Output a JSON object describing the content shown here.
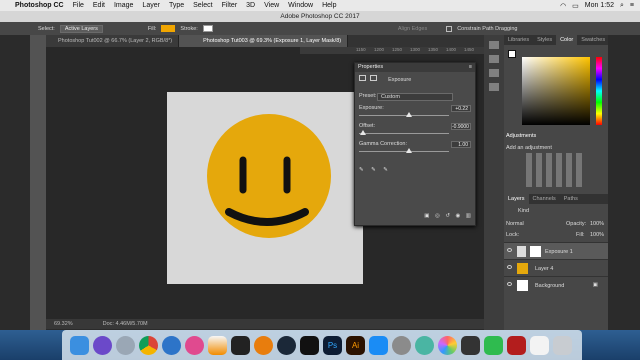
{
  "menubar": {
    "apple": "",
    "app": "Photoshop CC",
    "items": [
      "File",
      "Edit",
      "Image",
      "Layer",
      "Type",
      "Select",
      "Filter",
      "3D",
      "View",
      "Window",
      "Help"
    ],
    "clock": "Mon 1:52"
  },
  "titlebar": {
    "title": "Adobe Photoshop CC 2017"
  },
  "options": {
    "select_label": "Select:",
    "select_value": "Active Layers",
    "fill_label": "Fill:",
    "stroke_label": "Stroke:",
    "align_edges": "Align Edges",
    "constrain": "Constrain Path Dragging"
  },
  "tabs": [
    {
      "label": "Photoshop Tut002 @ 66.7% (Layer 2, RGB/8*)"
    },
    {
      "label": "Photoshop Tut003 @ 69.3% (Exposure 1, Layer Mask/8)"
    }
  ],
  "ruler": [
    "550",
    "600",
    "650",
    "700",
    "750",
    "800",
    "850",
    "900",
    "950",
    "1000",
    "1050",
    "1100",
    "1150",
    "1200",
    "1250",
    "1300",
    "1350",
    "1400",
    "1450",
    "1500"
  ],
  "properties": {
    "title": "Properties",
    "section": "Exposure",
    "preset_label": "Preset:",
    "preset_value": "Custom",
    "exposure_label": "Exposure:",
    "exposure_value": "+0.22",
    "exposure_pos": 0.55,
    "offset_label": "Offset:",
    "offset_value": "-0.9000",
    "offset_pos": 0.04,
    "gamma_label": "Gamma Correction:",
    "gamma_value": "1.00",
    "gamma_pos": 0.55
  },
  "right_panels": {
    "color_tabs": [
      "Libraries",
      "Styles",
      "Color",
      "Swatches"
    ],
    "active_color_tab": "Color",
    "adjustments_title": "Adjustments",
    "adjustments_hint": "Add an adjustment",
    "layer_tabs": [
      "Layers",
      "Channels",
      "Paths"
    ],
    "kind_label": "Kind",
    "blend_mode": "Normal",
    "opacity_label": "Opacity:",
    "opacity_value": "100%",
    "lock_label": "Lock:",
    "fill_label": "Fill:",
    "fill_value": "100%",
    "layers": [
      {
        "name": "Exposure 1"
      },
      {
        "name": "Layer 4"
      },
      {
        "name": "Background"
      }
    ]
  },
  "status": {
    "zoom": "69.32%",
    "doc": "Doc: 4.46M/5.70M"
  },
  "colors": {
    "smiley": "#e5a80c",
    "canvas": "#d8d8d8",
    "accent": "#2d74c8"
  },
  "dock_icons": [
    "finder-icon",
    "siri-icon",
    "launchpad-icon",
    "chrome-icon",
    "safari-icon",
    "itunes-icon",
    "vlc-icon",
    "unity-icon",
    "blender-icon",
    "steam-icon",
    "ghost-icon",
    "photoshop-icon",
    "illustrator-icon",
    "appstore-icon",
    "settings-icon",
    "atom-icon",
    "photos-icon",
    "dots-icon",
    "facetime-icon",
    "filezilla-icon",
    "trash-icon"
  ]
}
